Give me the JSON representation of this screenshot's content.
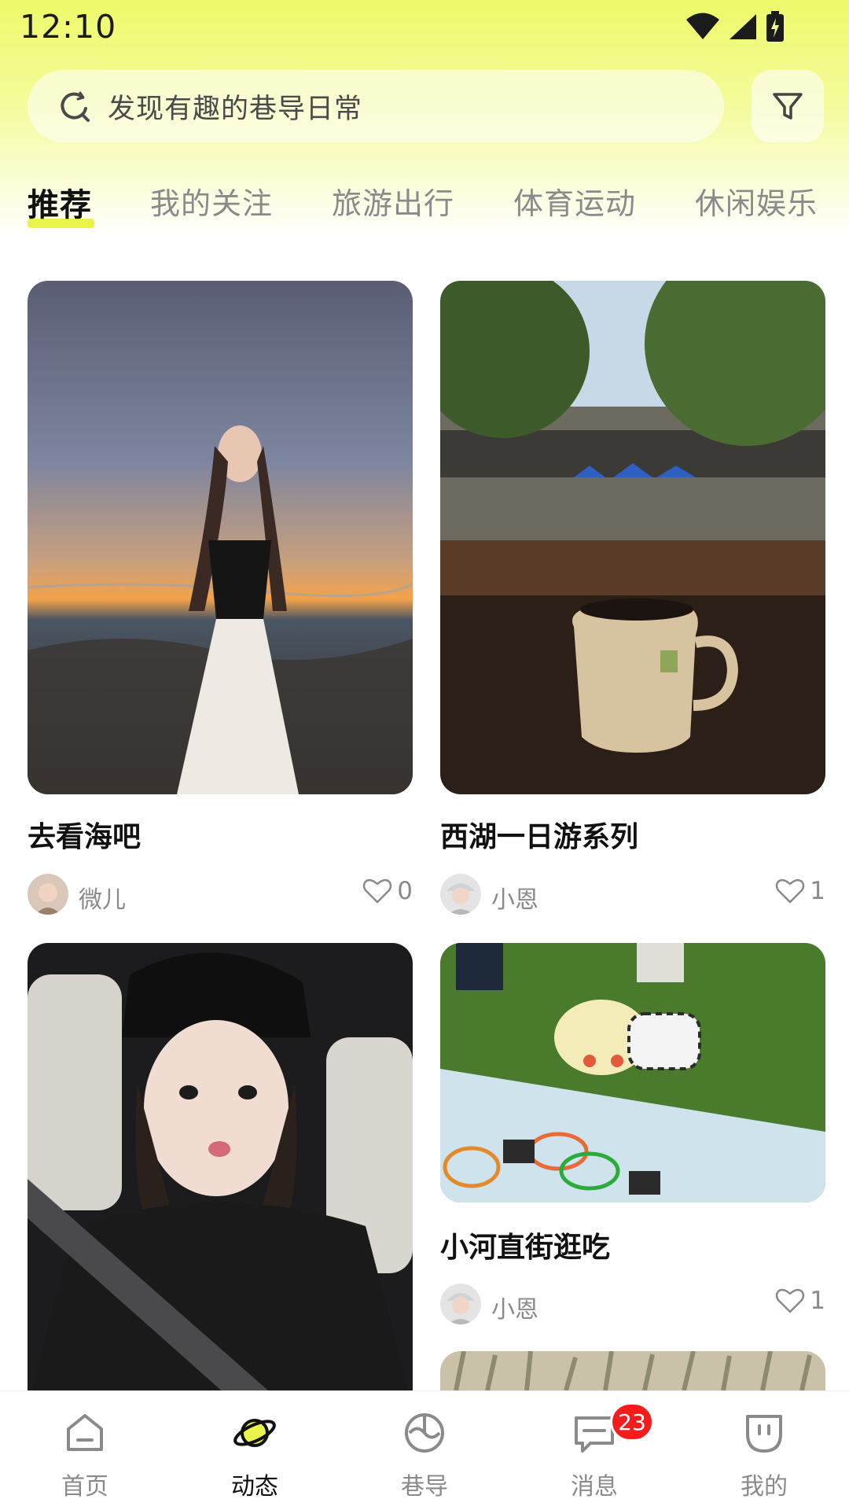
{
  "status_bar": {
    "time": "12:10"
  },
  "search": {
    "placeholder": "发现有趣的巷导日常"
  },
  "tabs": [
    {
      "label": "推荐",
      "active": true
    },
    {
      "label": "我的关注",
      "active": false
    },
    {
      "label": "旅游出行",
      "active": false
    },
    {
      "label": "体育运动",
      "active": false
    },
    {
      "label": "休闲娱乐",
      "active": false
    }
  ],
  "feed": [
    {
      "title": "去看海吧",
      "author": "微儿",
      "likes": "0",
      "image": "sunset-beach-photo"
    },
    {
      "title": "西湖一日游系列",
      "author": "小恩",
      "likes": "1",
      "image": "coffee-mug-plaza-photo"
    },
    {
      "title": "",
      "author": "",
      "likes": "",
      "image": "car-selfie-photo"
    },
    {
      "title": "小河直街逛吃",
      "author": "小恩",
      "likes": "1",
      "image": "child-picnic-photo"
    },
    {
      "title": "",
      "author": "",
      "likes": "",
      "image": "wheat-field-photo"
    }
  ],
  "bottom_nav": [
    {
      "label": "首页",
      "icon": "home-icon",
      "active": false
    },
    {
      "label": "动态",
      "icon": "planet-icon",
      "active": true
    },
    {
      "label": "巷导",
      "icon": "compass-icon",
      "active": false
    },
    {
      "label": "消息",
      "icon": "chat-icon",
      "active": false,
      "badge": "23"
    },
    {
      "label": "我的",
      "icon": "profile-icon",
      "active": false
    }
  ],
  "colors": {
    "accent": "#eaf34a",
    "badge": "#f51c1c"
  }
}
